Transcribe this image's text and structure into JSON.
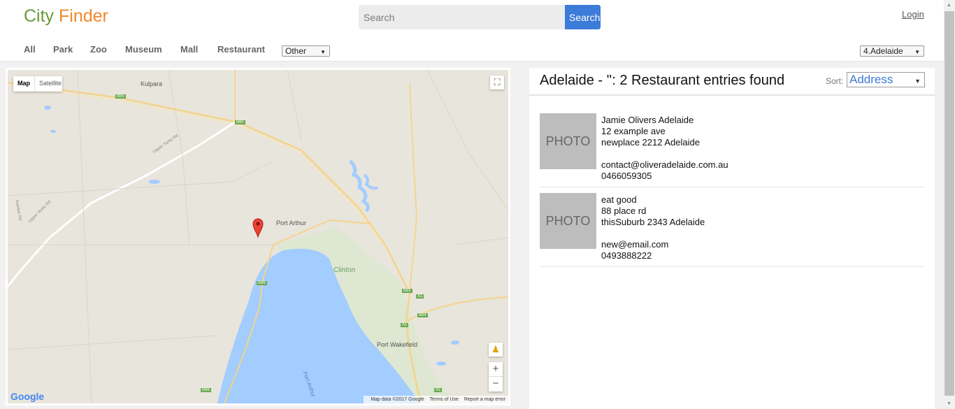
{
  "header": {
    "logo_part1": "City",
    "logo_part2": "Finder",
    "search_placeholder": "Search",
    "search_button": "Search",
    "login": "Login"
  },
  "nav": {
    "items": [
      "All",
      "Park",
      "Zoo",
      "Museum",
      "Mall",
      "Restaurant"
    ],
    "other_select": "Other",
    "city_select": "4.Adelaide"
  },
  "map": {
    "type_map": "Map",
    "type_satellite": "Satellite",
    "labels": {
      "kulpara": "Kulpara",
      "port_arthur": "Port Arthur",
      "clinton": "Clinton",
      "port_wakefield": "Port Wakefield",
      "port_arthur_water": "Port Arthur",
      "upper_yorke_rd": "Upper Yorke Rd",
      "kainton_rd": "Kainton Rd",
      "upper_yorke_rd_2": "Upper Yorke Rd"
    },
    "road_shields": [
      "B85",
      "B85",
      "B86",
      "B85",
      "A1",
      "B84",
      "A1",
      "B86",
      "A1"
    ],
    "google_logo": "Google",
    "attribution": [
      "Map data ©2017 Google",
      "Terms of Use",
      "Report a map error"
    ]
  },
  "results": {
    "title": "Adelaide - '': 2 Restaurant entries found",
    "sort_label": "Sort:",
    "sort_value": "Address",
    "entries": [
      {
        "photo": "PHOTO",
        "name": "Jamie Olivers Adelaide",
        "street": "12 example ave",
        "suburb": "newplace 2212 Adelaide",
        "email": "contact@oliveradelaide.com.au",
        "phone": "0466059305"
      },
      {
        "photo": "PHOTO",
        "name": "eat good",
        "street": "88 place rd",
        "suburb": "thisSuburb 2343 Adelaide",
        "email": "new@email.com",
        "phone": "0493888222"
      }
    ]
  },
  "colors": {
    "logo_city": "#6a9a3b",
    "logo_finder": "#f0892a",
    "search_button": "#3c7bd8",
    "water": "#a3ccff",
    "land": "#e8e5dc"
  }
}
